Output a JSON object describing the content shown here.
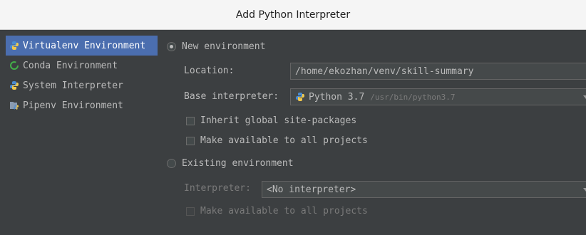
{
  "window": {
    "title": "Add Python Interpreter"
  },
  "sidebar": {
    "items": [
      {
        "label": "Virtualenv Environment",
        "icon": "python-icon",
        "selected": true
      },
      {
        "label": "Conda Environment",
        "icon": "conda-icon",
        "selected": false
      },
      {
        "label": "System Interpreter",
        "icon": "python-icon",
        "selected": false
      },
      {
        "label": "Pipenv Environment",
        "icon": "pipenv-icon",
        "selected": false
      }
    ]
  },
  "new_env": {
    "radio_label": "New environment",
    "selected": true,
    "location_label": "Location:",
    "location_value": "/home/ekozhan/venv/skill-summary",
    "base_label": "Base interpreter:",
    "base_value": "Python 3.7",
    "base_path": "/usr/bin/python3.7",
    "inherit_label": "Inherit global site-packages",
    "inherit_checked": false,
    "make_available_label": "Make available to all projects",
    "make_available_checked": false
  },
  "existing_env": {
    "radio_label": "Existing environment",
    "selected": false,
    "interpreter_label": "Interpreter:",
    "interpreter_value": "<No interpreter>",
    "make_available_label": "Make available to all projects",
    "make_available_checked": false
  },
  "colors": {
    "background": "#3c3f41",
    "selection": "#4b6eaf",
    "text": "#bbbbbb",
    "disabled_text": "#7a7a7a"
  }
}
